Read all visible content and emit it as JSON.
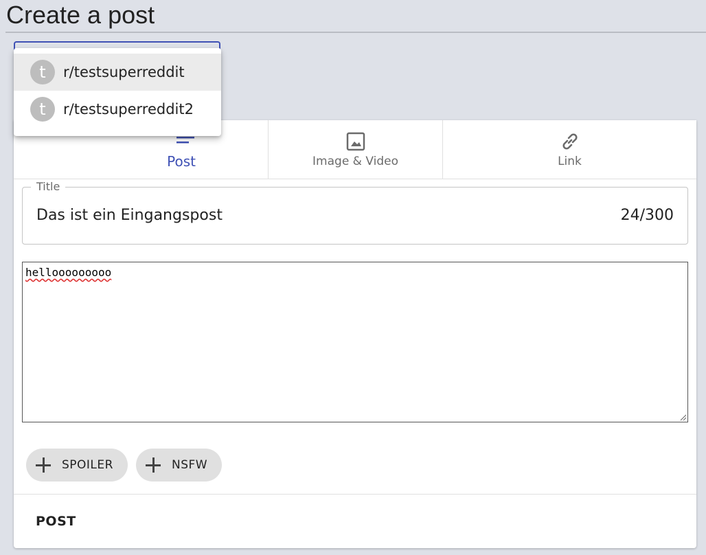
{
  "page": {
    "title": "Create a post"
  },
  "community_menu": {
    "items": [
      {
        "avatar": "t",
        "label": "r/testsuperreddit",
        "selected": true
      },
      {
        "avatar": "t",
        "label": "r/testsuperreddit2",
        "selected": false
      }
    ]
  },
  "tabs": [
    {
      "label": "Post",
      "icon": "text-lines-icon",
      "active": true
    },
    {
      "label": "Image & Video",
      "icon": "image-icon",
      "active": false
    },
    {
      "label": "Link",
      "icon": "link-icon",
      "active": false
    }
  ],
  "title_field": {
    "legend": "Title",
    "value": "Das ist ein Eingangspost",
    "counter": "24/300"
  },
  "body_field": {
    "value": "hellooooooooo"
  },
  "chips": {
    "spoiler": {
      "label": "SPOILER",
      "icon": "plus-icon"
    },
    "nsfw": {
      "label": "NSFW",
      "icon": "plus-icon"
    }
  },
  "actions": {
    "post_label": "POST"
  },
  "colors": {
    "accent": "#3f51b5",
    "background": "#dee1e8",
    "chip": "#e0e0e0"
  }
}
